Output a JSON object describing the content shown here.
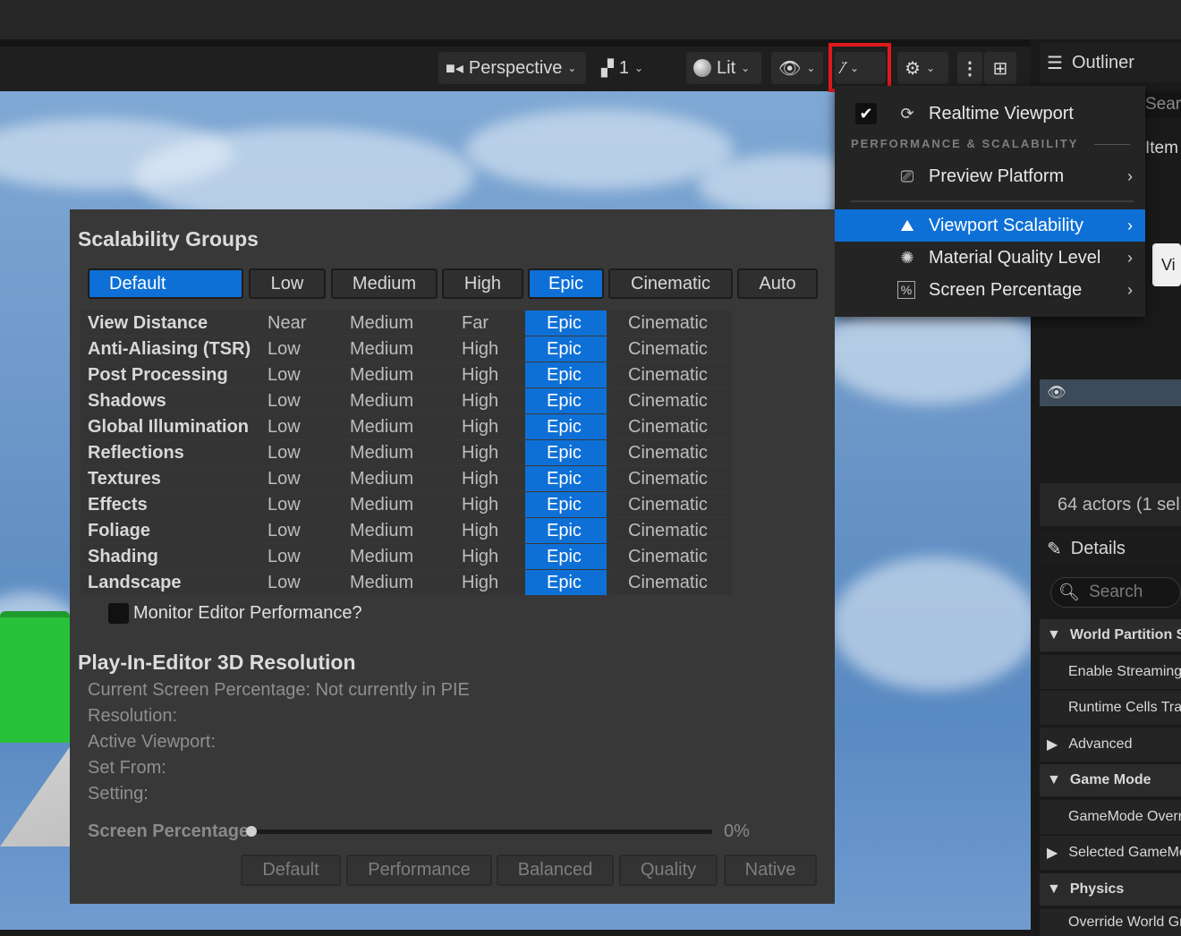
{
  "toolbar": {
    "perspective_label": "Perspective",
    "camera_count": "1",
    "lit_label": "Lit"
  },
  "outliner": {
    "title": "Outliner",
    "search_placeholder": "Sear",
    "items_label": "Item",
    "vi_label": "Vi",
    "actor_count": "64 actors (1 sel",
    "details_title": "Details",
    "details_search_placeholder": "Search",
    "rows": [
      {
        "label": "World Partition Se",
        "type": "header"
      },
      {
        "label": "Enable Streaming",
        "type": "sub"
      },
      {
        "label": "Runtime Cells Tra",
        "type": "sub"
      },
      {
        "label": "Advanced",
        "type": "collapsed"
      },
      {
        "label": "Game Mode",
        "type": "header"
      },
      {
        "label": "GameMode Overr",
        "type": "sub"
      },
      {
        "label": "Selected GameMo",
        "type": "collapsed"
      },
      {
        "label": "Physics",
        "type": "header"
      },
      {
        "label": "Override World Gr",
        "type": "sub"
      }
    ]
  },
  "menu": {
    "realtime_label": "Realtime Viewport",
    "realtime_checked": true,
    "section_header": "PERFORMANCE & SCALABILITY",
    "items": [
      {
        "label": "Preview Platform",
        "icon": "preview-platform-icon"
      },
      {
        "label": "Viewport Scalability",
        "icon": "scalability-icon",
        "selected": true
      },
      {
        "label": "Material Quality Level",
        "icon": "material-quality-icon"
      },
      {
        "label": "Screen Percentage",
        "icon": "screen-percentage-icon"
      }
    ]
  },
  "scalability": {
    "title": "Scalability Groups",
    "presets": [
      "Default",
      "Low",
      "Medium",
      "High",
      "Epic",
      "Cinematic",
      "Auto"
    ],
    "active_presets": [
      "Default",
      "Epic"
    ],
    "groups": [
      {
        "name": "View Distance",
        "levels": [
          "Near",
          "Medium",
          "Far",
          "Epic",
          "Cinematic"
        ]
      },
      {
        "name": "Anti-Aliasing (TSR)",
        "levels": [
          "Low",
          "Medium",
          "High",
          "Epic",
          "Cinematic"
        ]
      },
      {
        "name": "Post Processing",
        "levels": [
          "Low",
          "Medium",
          "High",
          "Epic",
          "Cinematic"
        ]
      },
      {
        "name": "Shadows",
        "levels": [
          "Low",
          "Medium",
          "High",
          "Epic",
          "Cinematic"
        ]
      },
      {
        "name": "Global Illumination",
        "levels": [
          "Low",
          "Medium",
          "High",
          "Epic",
          "Cinematic"
        ]
      },
      {
        "name": "Reflections",
        "levels": [
          "Low",
          "Medium",
          "High",
          "Epic",
          "Cinematic"
        ]
      },
      {
        "name": "Textures",
        "levels": [
          "Low",
          "Medium",
          "High",
          "Epic",
          "Cinematic"
        ]
      },
      {
        "name": "Effects",
        "levels": [
          "Low",
          "Medium",
          "High",
          "Epic",
          "Cinematic"
        ]
      },
      {
        "name": "Foliage",
        "levels": [
          "Low",
          "Medium",
          "High",
          "Epic",
          "Cinematic"
        ]
      },
      {
        "name": "Shading",
        "levels": [
          "Low",
          "Medium",
          "High",
          "Epic",
          "Cinematic"
        ]
      },
      {
        "name": "Landscape",
        "levels": [
          "Low",
          "Medium",
          "High",
          "Epic",
          "Cinematic"
        ]
      }
    ],
    "selected_level": "Epic",
    "monitor_label": "Monitor Editor Performance?",
    "monitor_checked": false
  },
  "pie": {
    "title": "Play-In-Editor 3D Resolution",
    "lines": [
      "Current Screen Percentage: Not currently in PIE",
      "Resolution:",
      "Active Viewport:",
      "Set From:",
      "Setting:"
    ],
    "screen_percentage_label": "Screen Percentage",
    "screen_percentage_value": "0%",
    "screen_percentage_fraction": 0,
    "buttons": [
      "Default",
      "Performance",
      "Balanced",
      "Quality",
      "Native"
    ]
  },
  "colors": {
    "accent": "#0e70d6",
    "highlight_border": "#e0191b",
    "panel_bg": "#383838"
  }
}
